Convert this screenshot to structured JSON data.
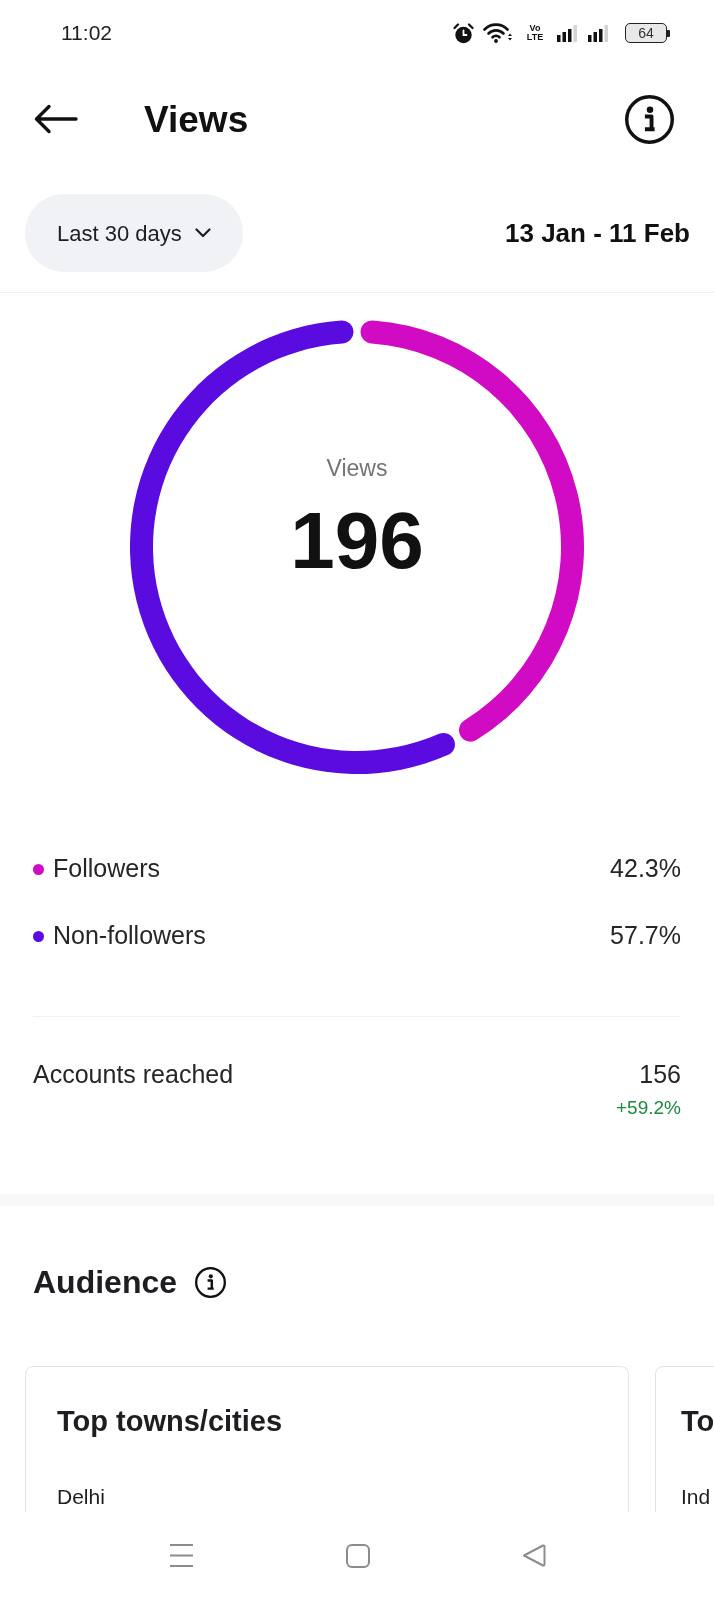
{
  "status_bar": {
    "time": "11:02",
    "volte": "Vo LTE",
    "battery": "64"
  },
  "header": {
    "title": "Views"
  },
  "filter": {
    "period": "Last 30 days",
    "date_range": "13 Jan - 11 Feb"
  },
  "breakdown": {
    "center_label": "Views",
    "total": "196",
    "chart_data": {
      "type": "donut",
      "categories": [
        "Followers",
        "Non-followers"
      ],
      "values": [
        42.3,
        57.7
      ],
      "colors": [
        "#d10ac4",
        "#5a0be0"
      ],
      "value_labels": [
        "42.3%",
        "57.7%"
      ]
    }
  },
  "accounts_reached": {
    "label": "Accounts reached",
    "value": "156",
    "change": "+59.2%"
  },
  "audience": {
    "title": "Audience",
    "cards": [
      {
        "title": "Top towns/cities",
        "rows": [
          "Delhi"
        ]
      },
      {
        "title": "To",
        "rows": [
          "Ind"
        ]
      }
    ]
  }
}
